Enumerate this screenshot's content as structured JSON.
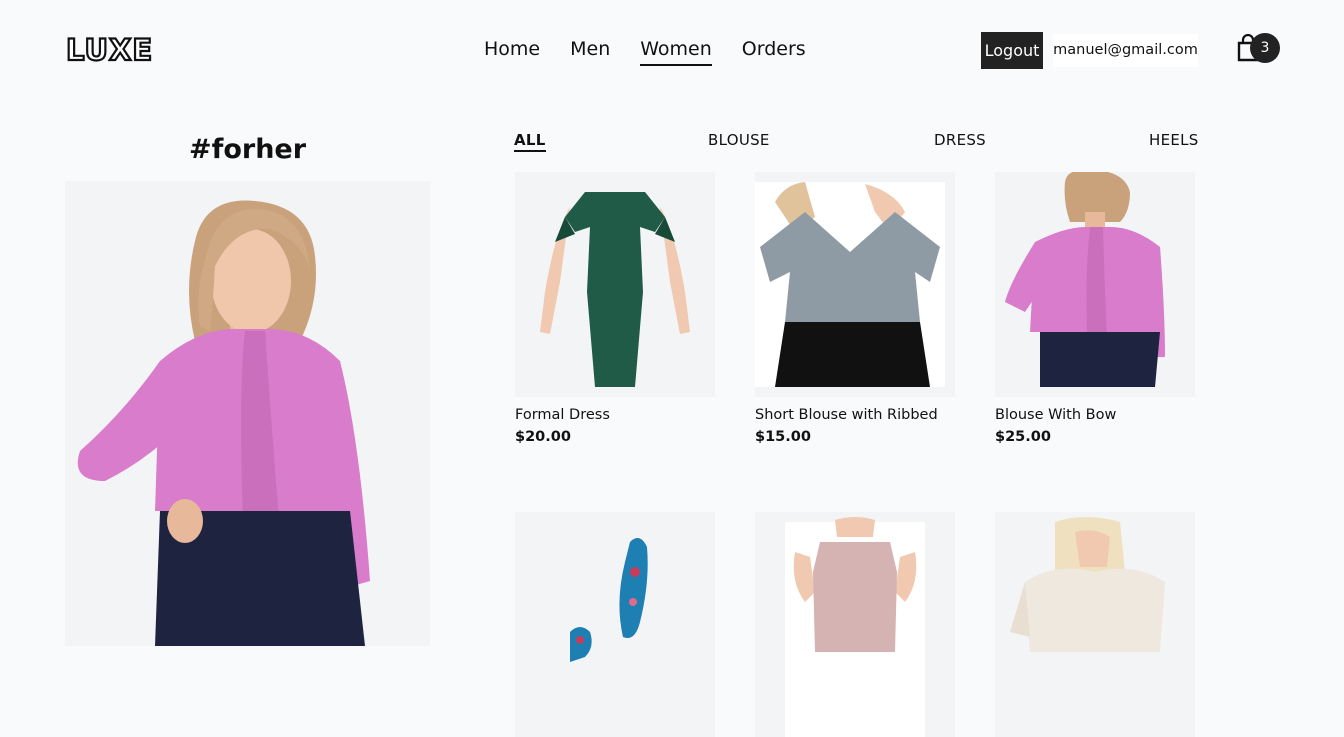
{
  "header": {
    "logo": "LUXE",
    "nav": [
      "Home",
      "Men",
      "Women",
      "Orders"
    ],
    "active_nav": "Women",
    "logout_label": "Logout",
    "email": "manuel@gmail.com",
    "cart_count": "3"
  },
  "featured": {
    "tag": "#forher"
  },
  "filters": {
    "items": [
      "ALL",
      "BLOUSE",
      "DRESS",
      "HEELS"
    ],
    "active": "ALL"
  },
  "products": [
    {
      "name": "Formal Dress",
      "price": "$20.00",
      "color": "#1f5b46"
    },
    {
      "name": "Short Blouse with Ribbed",
      "price": "$15.00",
      "color": "#8e9ba4"
    },
    {
      "name": "Blouse With Bow",
      "price": "$25.00",
      "color": "#d97ccb"
    },
    {
      "name": "",
      "price": "",
      "color": "#1e7fb3"
    },
    {
      "name": "",
      "price": "",
      "color": "#d4b3b2"
    },
    {
      "name": "",
      "price": "",
      "color": "#efe8de"
    }
  ],
  "colors": {
    "background": "#f9fafc",
    "dark": "#222222",
    "image_bg": "#f3f4f6",
    "blouse_pink": "#d97ccb",
    "pants_navy": "#1e2440"
  }
}
